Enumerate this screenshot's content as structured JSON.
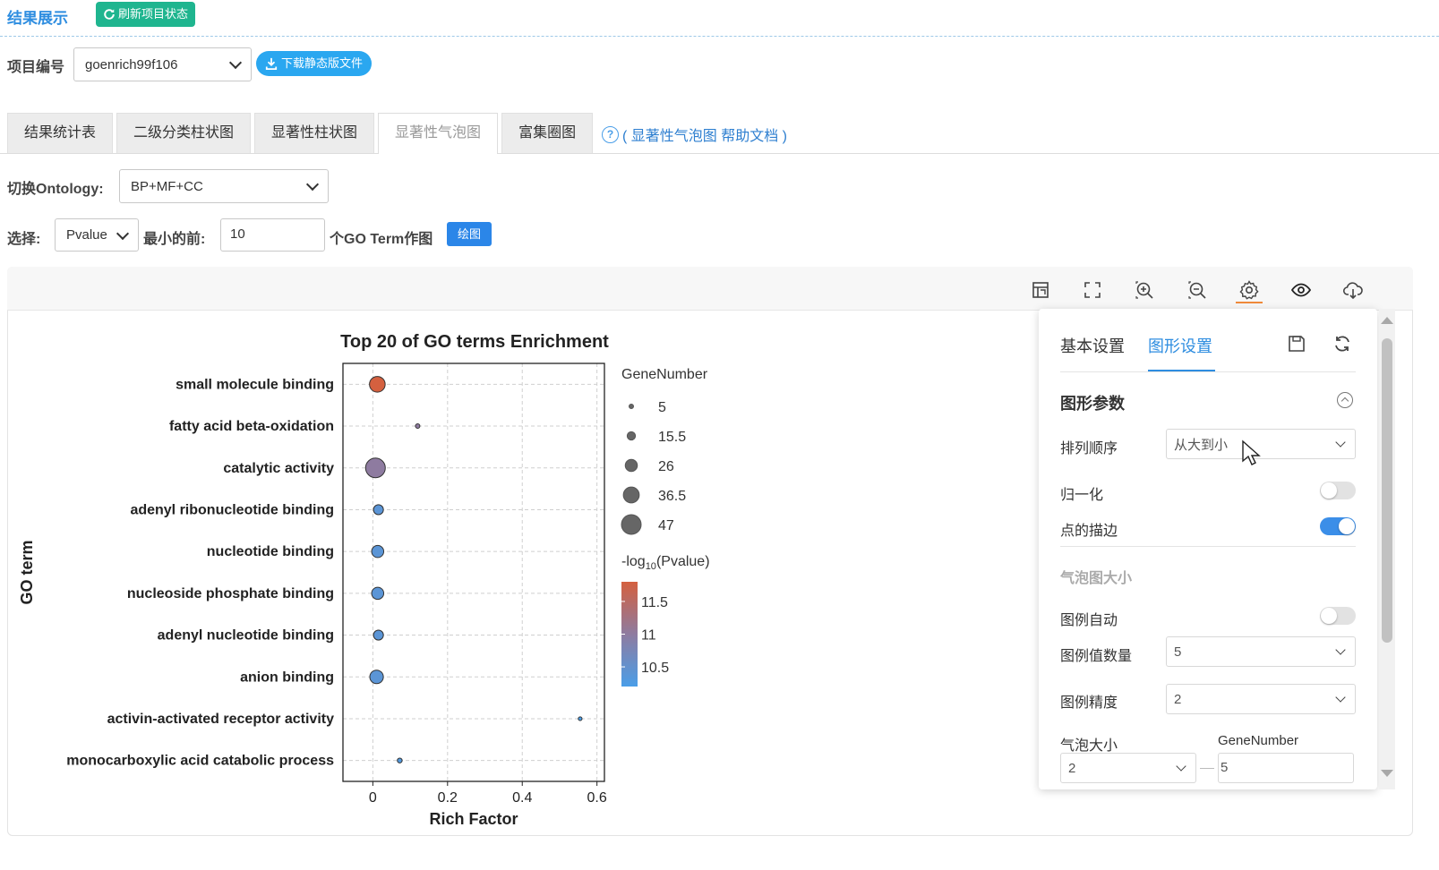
{
  "header": {
    "title": "结果展示",
    "refresh_label": "刷新项目状态"
  },
  "project": {
    "label": "项目编号",
    "value": "goenrich99f106",
    "download_label": "下载静态版文件"
  },
  "tabs": [
    {
      "label": "结果统计表",
      "active": false
    },
    {
      "label": "二级分类柱状图",
      "active": false
    },
    {
      "label": "显著性柱状图",
      "active": false
    },
    {
      "label": "显著性气泡图",
      "active": true
    },
    {
      "label": "富集圈图",
      "active": false
    }
  ],
  "help": {
    "text": "( 显著性气泡图 帮助文档 )"
  },
  "ontology": {
    "label": "切换Ontology:",
    "value": "BP+MF+CC"
  },
  "filter": {
    "select_label": "选择:",
    "select_value": "Pvalue",
    "min_label": "最小的前:",
    "count": "10",
    "suffix": "个GO Term作图",
    "draw_label": "绘图"
  },
  "settings": {
    "tab_basic": "基本设置",
    "tab_graph": "图形设置",
    "section_title": "图形参数",
    "sort_label": "排列顺序",
    "sort_value": "从大到小",
    "normalize_label": "归一化",
    "normalize_on": false,
    "stroke_label": "点的描边",
    "stroke_on": true,
    "bubble_section": "气泡图大小",
    "legend_auto_label": "图例自动",
    "legend_auto_on": false,
    "legend_count_label": "图例值数量",
    "legend_count_value": "5",
    "legend_precision_label": "图例精度",
    "legend_precision_value": "2",
    "bubble_size_label": "气泡大小",
    "bubble_size_value": "2",
    "gene_number_label": "GeneNumber",
    "gene_number_value": "5"
  },
  "colors": {
    "accent": "#2e8de0",
    "high": "#d4603f",
    "mid": "#8e7ba0",
    "low": "#4a9ee8"
  },
  "chart_data": {
    "type": "scatter",
    "title": "Top 20 of GO terms Enrichment",
    "xlabel": "Rich Factor",
    "ylabel": "GO term",
    "xlim": [
      -0.08,
      0.62
    ],
    "xticks": [
      "0",
      "0.2",
      "0.4",
      "0.6"
    ],
    "xtick_values": [
      0,
      0.2,
      0.4,
      0.6
    ],
    "grid": true,
    "legend_placement": "right",
    "size_legend": {
      "title": "GeneNumber",
      "values": [
        5,
        15.5,
        26,
        36.5,
        47
      ]
    },
    "color_legend": {
      "title_prefix": "-log",
      "title_sub": "10",
      "title_suffix": "(Pvalue)",
      "ticks": [
        11.5,
        11,
        10.5
      ],
      "range": [
        10.2,
        11.8
      ]
    },
    "points": [
      {
        "term": "small molecule binding",
        "x": 0.012,
        "size": 36,
        "color": 11.8
      },
      {
        "term": "fatty acid beta-oxidation",
        "x": 0.12,
        "size": 5,
        "color": 11.0
      },
      {
        "term": "catalytic activity",
        "x": 0.007,
        "size": 47,
        "color": 11.0
      },
      {
        "term": "adenyl ribonucleotide binding",
        "x": 0.015,
        "size": 20,
        "color": 10.4
      },
      {
        "term": "nucleotide binding",
        "x": 0.013,
        "size": 26,
        "color": 10.4
      },
      {
        "term": "nucleoside phosphate binding",
        "x": 0.013,
        "size": 26,
        "color": 10.4
      },
      {
        "term": "adenyl nucleotide binding",
        "x": 0.015,
        "size": 20,
        "color": 10.4
      },
      {
        "term": "anion binding",
        "x": 0.01,
        "size": 30,
        "color": 10.4
      },
      {
        "term": "activin-activated receptor activity",
        "x": 0.555,
        "size": 3,
        "color": 10.2
      },
      {
        "term": "monocarboxylic acid catabolic process",
        "x": 0.072,
        "size": 6,
        "color": 10.3
      }
    ]
  }
}
